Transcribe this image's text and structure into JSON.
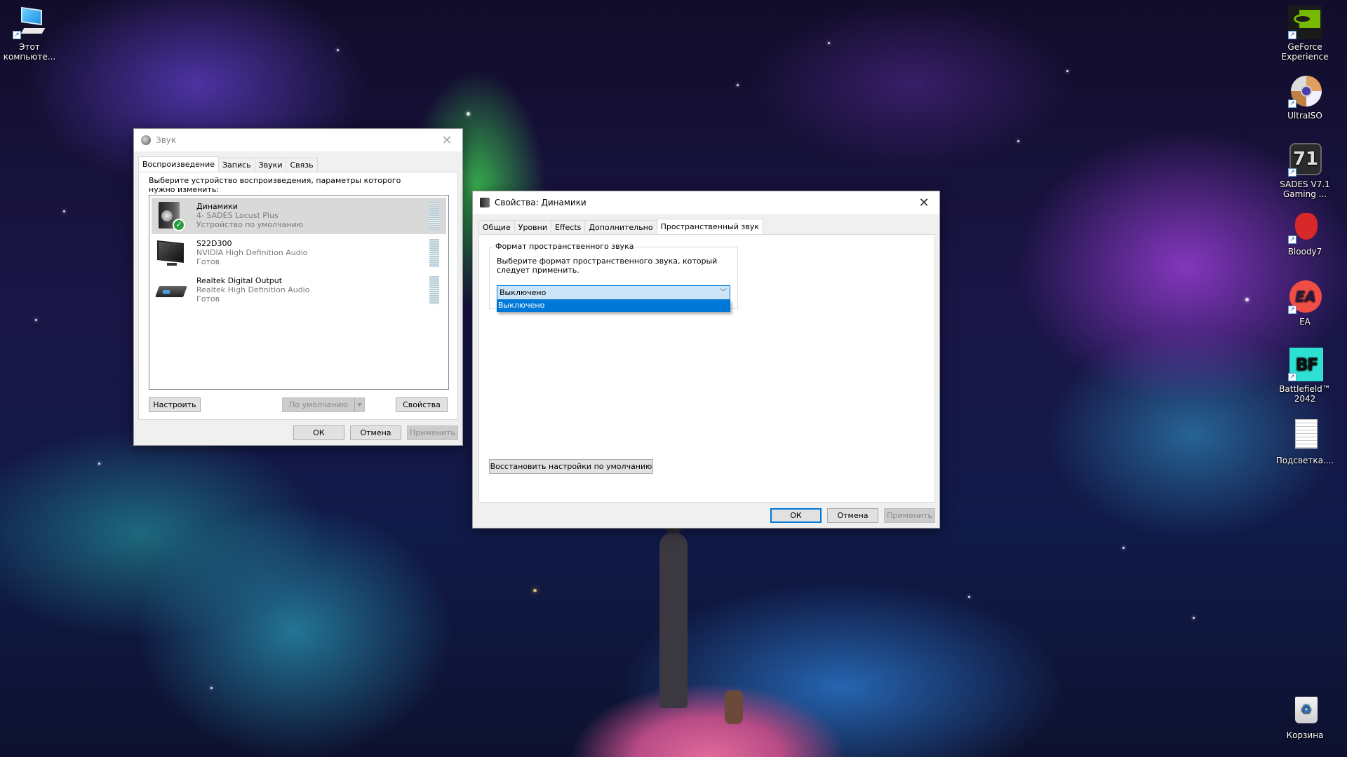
{
  "desktop": {
    "left_icons": [
      {
        "label": "Этот компьюте...",
        "icon": "this-pc-icon"
      }
    ],
    "right_icons": [
      {
        "label": "GeForce Experience",
        "icon": "geforce-experience-icon"
      },
      {
        "label": "UltraISO",
        "icon": "ultraiso-icon"
      },
      {
        "label": "SADES V7.1 Gaming ...",
        "icon": "sades-icon"
      },
      {
        "label": "Bloody7",
        "icon": "bloody7-icon"
      },
      {
        "label": "EA",
        "icon": "ea-icon"
      },
      {
        "label": "Battlefield™ 2042",
        "icon": "battlefield-icon"
      },
      {
        "label": "Подсветка....",
        "icon": "text-file-icon"
      },
      {
        "label": "Корзина",
        "icon": "recycle-bin-icon"
      }
    ]
  },
  "sound_dialog": {
    "title": "Звук",
    "close_glyph": "✕",
    "tabs": [
      "Воспроизведение",
      "Запись",
      "Звуки",
      "Связь"
    ],
    "active_tab": 0,
    "instruction": "Выберите устройство воспроизведения, параметры которого нужно изменить:",
    "devices": [
      {
        "name": "Динамики",
        "driver": "4- SADES Locust Plus",
        "status": "Устройство по умолчанию",
        "selected": true,
        "default": true,
        "icon": "speaker-icon"
      },
      {
        "name": "S22D300",
        "driver": "NVIDIA High Definition Audio",
        "status": "Готов",
        "selected": false,
        "default": false,
        "icon": "monitor-icon"
      },
      {
        "name": "Realtek Digital Output",
        "driver": "Realtek High Definition Audio",
        "status": "Готов",
        "selected": false,
        "default": false,
        "icon": "digital-output-icon"
      }
    ],
    "buttons": {
      "configure": "Настроить",
      "set_default": "По умолчанию",
      "properties": "Свойства",
      "ok": "ОК",
      "cancel": "Отмена",
      "apply": "Применить"
    }
  },
  "properties_dialog": {
    "title": "Свойства: Динамики",
    "close_glyph": "✕",
    "tabs": [
      "Общие",
      "Уровни",
      "Effects",
      "Дополнительно",
      "Пространственный звук"
    ],
    "active_tab": 4,
    "group_title": "Формат пространственного звука",
    "group_text": "Выберите формат пространственного звука, который следует применить.",
    "format_select": {
      "value": "Выключено",
      "options": [
        "Выключено"
      ],
      "highlighted_option": "Выключено",
      "open": true
    },
    "buttons": {
      "restore_defaults": "Восстановить настройки по умолчанию",
      "ok": "ОК",
      "cancel": "Отмена",
      "apply": "Применить"
    }
  }
}
